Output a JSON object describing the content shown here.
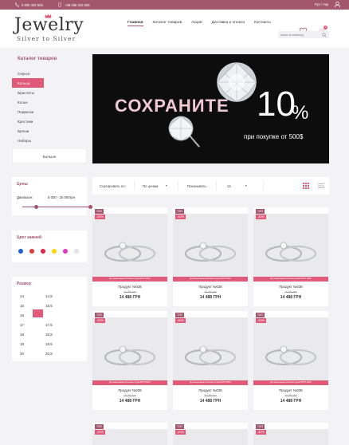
{
  "topbar": {
    "phone1": "0 800 302 505",
    "phone2": "+38 095 303 505",
    "lang": "Рус / Укр"
  },
  "logo": {
    "word": "Jewelry",
    "sub": "Silver to Silver"
  },
  "nav": [
    "Главная",
    "Каталог товаров",
    "Акции",
    "Доставка и оплата",
    "Контакты"
  ],
  "search": {
    "placeholder": "поиск по каталогу"
  },
  "cart": {
    "count": "0"
  },
  "sidebar": {
    "title": "Каталог товаров",
    "items": [
      "Серьги",
      "Кольца",
      "Браслеты",
      "Колье",
      "Подвески",
      "Крестики",
      "Броши",
      "Наборы"
    ],
    "more": "Больше"
  },
  "banner": {
    "save": "СОХРАНИТЕ",
    "pct": "10",
    "sign": "%",
    "sub": "при покупке от 500$"
  },
  "price": {
    "title": "Цены",
    "label": "Диапазон:",
    "value": "5 000 - 25 000грн"
  },
  "colors": {
    "title": "Цвет камней",
    "swatches": [
      "#1f5fd6",
      "#e13a3a",
      "#e0244a",
      "#ffd800",
      "#e637c4",
      "#e9e6ee"
    ]
  },
  "size": {
    "title": "Размер",
    "values": [
      "14",
      "14,5",
      "15",
      "15,5",
      "16",
      "16,5",
      "17",
      "17,5",
      "18",
      "18,5",
      "19",
      "19,5",
      "20",
      "20,5"
    ]
  },
  "sortbar": {
    "sort_label": "Сортировать по:",
    "sort_value": "По ценам",
    "show_label": "Показывать:",
    "show_value": "12"
  },
  "products": {
    "top": "TOП",
    "sale": "-40%",
    "strip": "До конца акции осталось 3 дня 08.07.2023",
    "name": "Продукт №038",
    "old": "20 280 грн",
    "new": "14 488 ГРН"
  }
}
